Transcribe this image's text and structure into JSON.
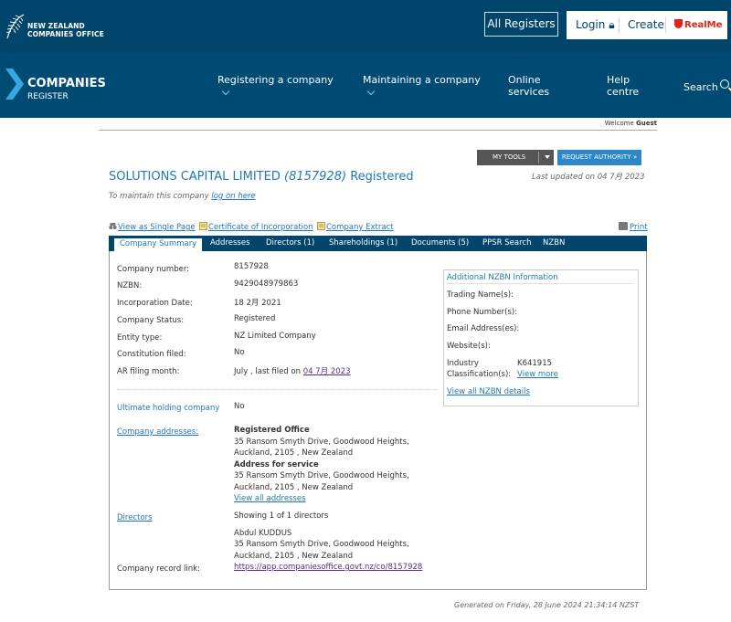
{
  "header": {
    "org_line1": "NEW ZEALAND",
    "org_line2": "COMPANIES OFFICE",
    "all_registers": "All Registers",
    "login": "Login",
    "create": "Create",
    "realme": "RealMe"
  },
  "nav": {
    "logo_line1": "COMPANIES",
    "logo_line2": "REGISTER",
    "items": [
      {
        "label": "Registering a company"
      },
      {
        "label": "Maintaining a company"
      },
      {
        "label_line1": "Online",
        "label_line2": "services"
      },
      {
        "label_line1": "Help",
        "label_line2": "centre"
      }
    ],
    "search": "Search"
  },
  "welcome": {
    "prefix": "Welcome",
    "user": "Guest"
  },
  "tools": {
    "my_tools": "MY TOOLS",
    "request_authority": "REQUEST AUTHORITY »"
  },
  "company": {
    "name": "SOLUTIONS CAPITAL LIMITED",
    "number_paren": "(8157928)",
    "status_suffix": "Registered",
    "last_updated": "Last updated on 04 7月 2023",
    "maintain_prefix": "To maintain this company",
    "maintain_link": "log on here"
  },
  "links": {
    "single_page": "View as Single Page",
    "certificate": "Certificate of Incorporation",
    "extract": "Company Extract",
    "print": "Print"
  },
  "tabs": [
    "Company Summary",
    "Addresses",
    "Directors (1)",
    "Shareholdings (1)",
    "Documents (5)",
    "PPSR Search",
    "NZBN"
  ],
  "summary": {
    "company_number_label": "Company number:",
    "company_number": "8157928",
    "nzbn_label": "NZBN:",
    "nzbn": "9429048979863",
    "incorporation_label": "Incorporation Date:",
    "incorporation": "18 2月 2021",
    "status_label": "Company Status:",
    "status": "Registered",
    "entity_label": "Entity type:",
    "entity": "NZ Limited Company",
    "constitution_label": "Constitution filed:",
    "constitution": "No",
    "ar_label": "AR filing month:",
    "ar_prefix": "July , last filed on",
    "ar_date": "04 7月 2023",
    "ultimate_label": "Ultimate holding company",
    "ultimate": "No",
    "addresses_label": "Company addresses:",
    "registered_office_title": "Registered Office",
    "registered_office_l1": "35 Ransom Smyth Drive, Goodwood Heights,",
    "registered_office_l2": "Auckland, 2105 , New Zealand",
    "service_title": "Address for service",
    "service_l1": "35 Ransom Smyth Drive, Goodwood Heights,",
    "service_l2": "Auckland, 2105 , New Zealand",
    "view_all_addresses": "View all addresses",
    "directors_label": "Directors",
    "directors_showing": "Showing 1 of 1 directors",
    "director_name": "Abdul KUDDUS",
    "director_l1": "35 Ransom Smyth Drive, Goodwood Heights,",
    "director_l2": "Auckland, 2105 , New Zealand",
    "record_label": "Company record link:",
    "record_link": "https://app.companiesoffice.govt.nz/co/8157928"
  },
  "nzbn_box": {
    "title": "Additional NZBN Information",
    "trading_names": "Trading Name(s):",
    "phone": "Phone Number(s):",
    "email": "Email Address(es):",
    "website": "Website(s):",
    "industry_l1": "Industry",
    "industry_l2": "Classification(s):",
    "industry_code": "K641915",
    "view_more": "View more",
    "view_all": "View all NZBN details"
  },
  "footer": {
    "generated": "Generated on Friday, 28 June 2024 21:34:14 NZST"
  },
  "colors": {
    "header_bg": "#00456b",
    "nav_bg": "#004b73",
    "link": "#2178b8",
    "request_btn": "#2d87c6"
  }
}
